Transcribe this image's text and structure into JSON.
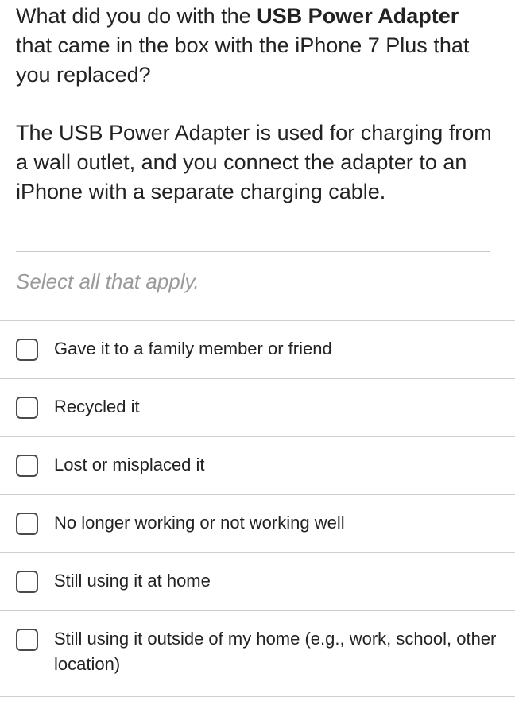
{
  "question": {
    "prefix": "What did you do with the ",
    "bold": "USB Power Adapter",
    "suffix": " that came in the box with the iPhone 7 Plus that you replaced?"
  },
  "description": "The USB Power Adapter is used for charging from a wall outlet, and you connect the adapter to an iPhone with a separate charging cable.",
  "instruction": "Select all that apply.",
  "options": [
    {
      "label": "Gave it to a family member or friend",
      "checked": false
    },
    {
      "label": "Recycled it",
      "checked": false
    },
    {
      "label": "Lost or misplaced it",
      "checked": false
    },
    {
      "label": "No longer working or not working well",
      "checked": false
    },
    {
      "label": "Still using it at home",
      "checked": false
    },
    {
      "label": "Still using it outside of my home (e.g., work, school, other location)",
      "checked": false
    }
  ]
}
